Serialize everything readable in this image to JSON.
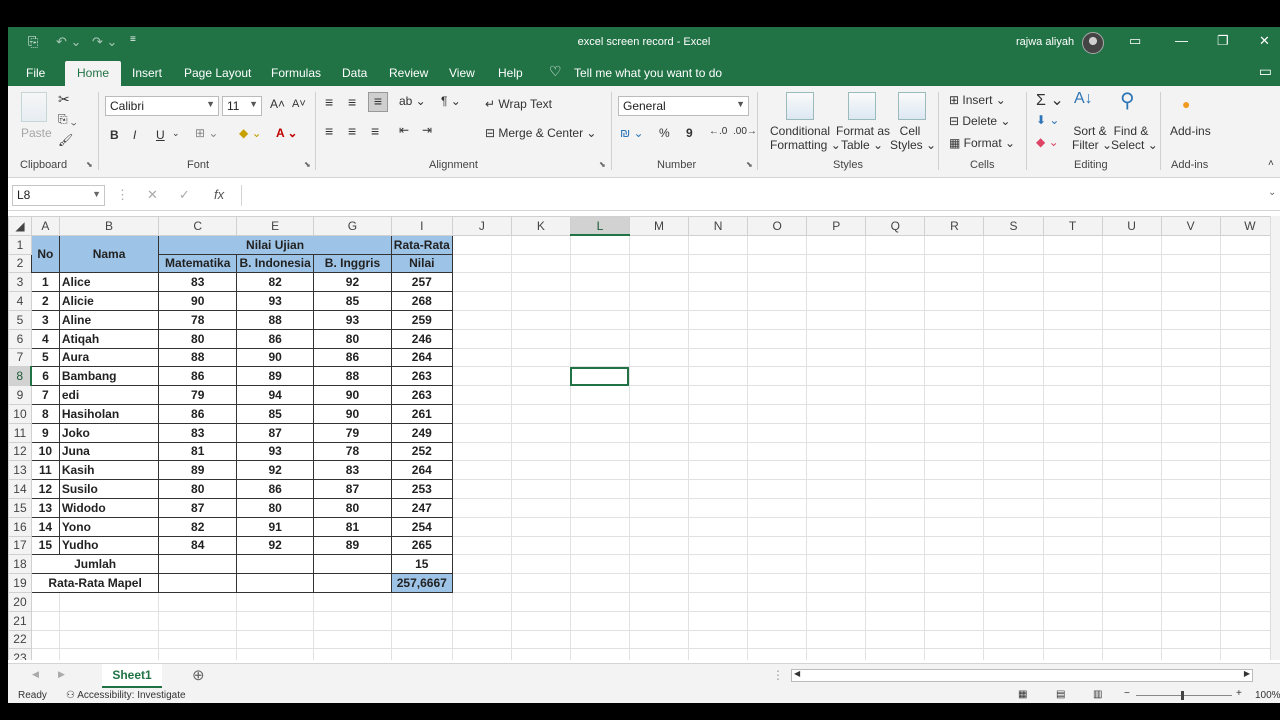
{
  "title": {
    "text": "excel screen record  -  Excel",
    "user": "rajwa aliyah"
  },
  "tabs": [
    "File",
    "Home",
    "Insert",
    "Page Layout",
    "Formulas",
    "Data",
    "Review",
    "View",
    "Help"
  ],
  "tell_me": "Tell me what you want to do",
  "ribbon": {
    "clipboard": {
      "paste": "Paste",
      "label": "Clipboard"
    },
    "font": {
      "name": "Calibri",
      "size": "11",
      "bold": "B",
      "italic": "I",
      "underline": "U",
      "label": "Font"
    },
    "alignment": {
      "wrap": "Wrap Text",
      "merge": "Merge & Center",
      "label": "Alignment"
    },
    "number": {
      "format": "General",
      "percent": "%",
      "comma": "9",
      "label": "Number"
    },
    "styles": {
      "conditional_1": "Conditional",
      "conditional_2": "Formatting",
      "format_table_1": "Format as",
      "format_table_2": "Table",
      "cell_styles_1": "Cell",
      "cell_styles_2": "Styles",
      "label": "Styles"
    },
    "cells": {
      "insert": "Insert",
      "delete": "Delete",
      "format": "Format",
      "label": "Cells"
    },
    "editing": {
      "sort_1": "Sort &",
      "sort_2": "Filter",
      "find_1": "Find &",
      "find_2": "Select",
      "label": "Editing"
    },
    "addins": {
      "addins": "Add-ins",
      "label": "Add-ins"
    }
  },
  "formula_bar": {
    "name_box": "L8",
    "fx": "fx",
    "formula": ""
  },
  "columns": [
    "A",
    "B",
    "C",
    "E",
    "G",
    "I",
    "J",
    "K",
    "L",
    "M",
    "N",
    "O",
    "P",
    "Q",
    "R",
    "S",
    "T",
    "U",
    "V",
    "W"
  ],
  "rows": [
    "1",
    "2",
    "3",
    "4",
    "5",
    "6",
    "7",
    "8",
    "9",
    "10",
    "11",
    "12",
    "13",
    "14",
    "15",
    "16",
    "17",
    "18",
    "19",
    "20",
    "21",
    "22",
    "23"
  ],
  "table": {
    "hdr_no": "No",
    "hdr_nama": "Nama",
    "hdr_nilai_ujian": "Nilai Ujian",
    "hdr_rata_1": "Rata-Rata",
    "hdr_rata_2": "Nilai",
    "hdr_mtk": "Matematika",
    "hdr_bind": "B. Indonesia",
    "hdr_bing": "B. Inggris",
    "records": [
      [
        "1",
        "Alice",
        "83",
        "82",
        "92",
        "257"
      ],
      [
        "2",
        "Alicie",
        "90",
        "93",
        "85",
        "268"
      ],
      [
        "3",
        "Aline",
        "78",
        "88",
        "93",
        "259"
      ],
      [
        "4",
        "Atiqah",
        "80",
        "86",
        "80",
        "246"
      ],
      [
        "5",
        "Aura",
        "88",
        "90",
        "86",
        "264"
      ],
      [
        "6",
        "Bambang",
        "86",
        "89",
        "88",
        "263"
      ],
      [
        "7",
        "edi",
        "79",
        "94",
        "90",
        "263"
      ],
      [
        "8",
        "Hasiholan",
        "86",
        "85",
        "90",
        "261"
      ],
      [
        "9",
        "Joko",
        "83",
        "87",
        "79",
        "249"
      ],
      [
        "10",
        "Juna",
        "81",
        "93",
        "78",
        "252"
      ],
      [
        "11",
        "Kasih",
        "89",
        "92",
        "83",
        "264"
      ],
      [
        "12",
        "Susilo",
        "80",
        "86",
        "87",
        "253"
      ],
      [
        "13",
        "Widodo",
        "87",
        "80",
        "80",
        "247"
      ],
      [
        "14",
        "Yono",
        "82",
        "91",
        "81",
        "254"
      ],
      [
        "15",
        "Yudho",
        "84",
        "92",
        "89",
        "265"
      ]
    ],
    "jumlah_label": "Jumlah",
    "jumlah_value": "15",
    "rata_mapel_label": "Rata-Rata Mapel",
    "rata_mapel_value": "257,6667"
  },
  "sheet": {
    "name": "Sheet1"
  },
  "status": {
    "ready": "Ready",
    "accessibility": "Accessibility: Investigate",
    "zoom": "100%"
  },
  "colors": {
    "accent": "#217346",
    "header_fill": "#9dc3e6"
  }
}
